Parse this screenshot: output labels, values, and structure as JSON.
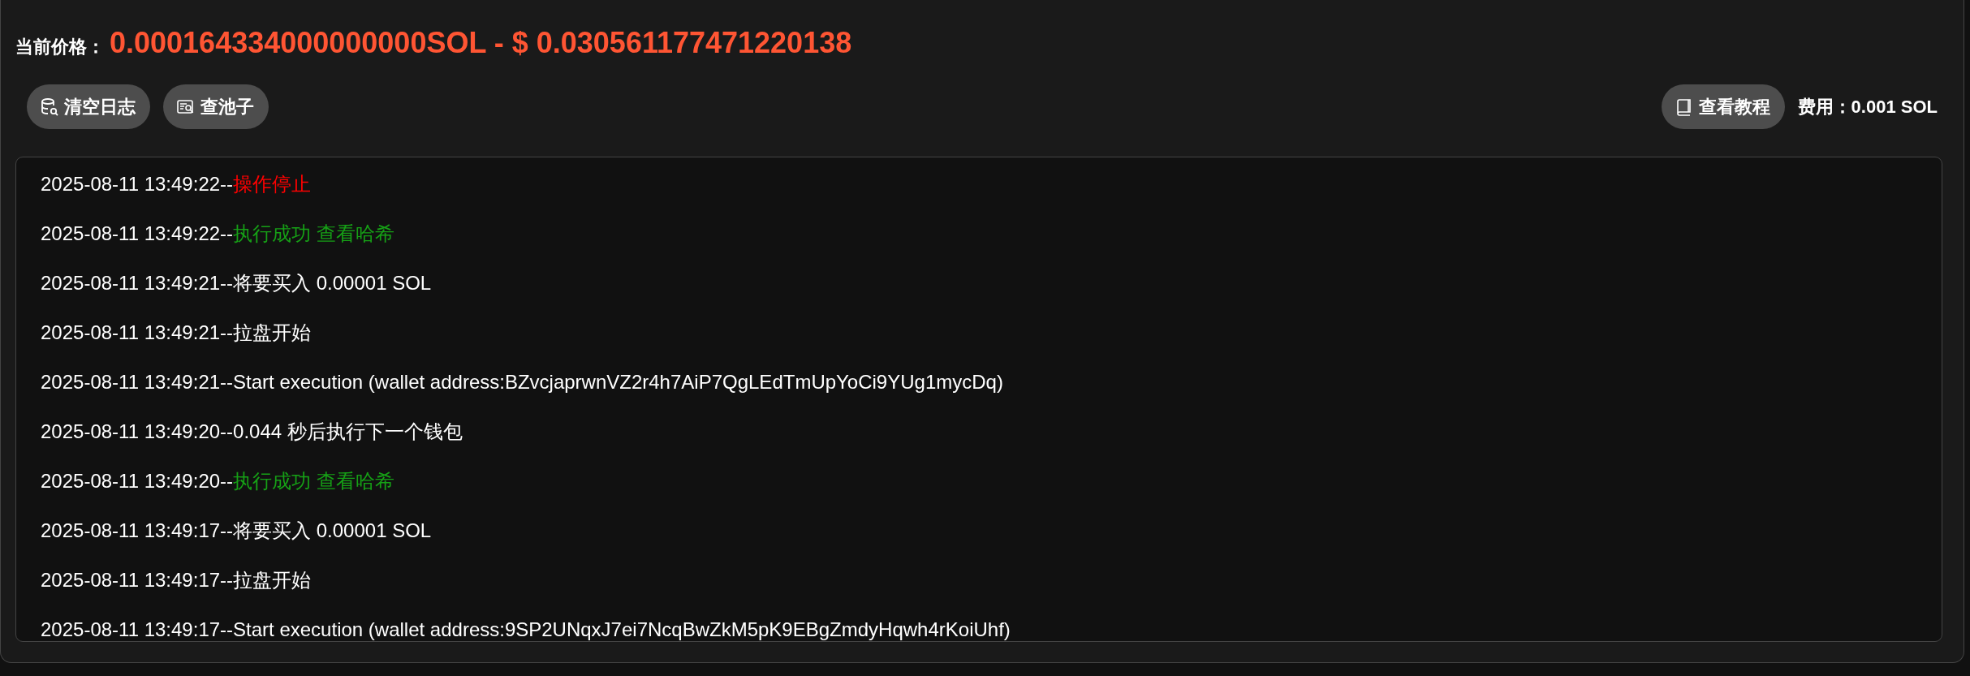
{
  "price": {
    "label": "当前价格：",
    "value": "0.000164334000000000SOL - $ 0.030561177471220138"
  },
  "toolbar": {
    "left_buttons": [
      {
        "label": "清空日志",
        "kind": "clear"
      },
      {
        "label": "查池子",
        "kind": "pool"
      }
    ],
    "right_buttons": [
      {
        "label": "查看教程",
        "kind": "tutorial"
      }
    ],
    "fee": "费用：0.001 SOL"
  },
  "log": [
    {
      "time": "2025-08-11 13:49:22--",
      "kind": "error",
      "text": "操作停止"
    },
    {
      "time": "2025-08-11 13:49:22--",
      "kind": "success",
      "text": "执行成功",
      "link": "查看哈希"
    },
    {
      "time": "2025-08-11 13:49:21--",
      "kind": "info",
      "text": "将要买入 0.00001 SOL"
    },
    {
      "time": "2025-08-11 13:49:21--",
      "kind": "info",
      "text": "拉盘开始"
    },
    {
      "time": "2025-08-11 13:49:21--",
      "kind": "info",
      "text": "Start execution (wallet address:BZvcjaprwnVZ2r4h7AiP7QgLEdTmUpYoCi9YUg1mycDq)"
    },
    {
      "time": "2025-08-11 13:49:20--",
      "kind": "info",
      "text": "0.044 秒后执行下一个钱包"
    },
    {
      "time": "2025-08-11 13:49:20--",
      "kind": "success",
      "text": "执行成功",
      "link": "查看哈希"
    },
    {
      "time": "2025-08-11 13:49:17--",
      "kind": "info",
      "text": "将要买入 0.00001 SOL"
    },
    {
      "time": "2025-08-11 13:49:17--",
      "kind": "info",
      "text": "拉盘开始"
    },
    {
      "time": "2025-08-11 13:49:17--",
      "kind": "info",
      "text": "Start execution (wallet address:9SP2UNqxJ7ei7NcqBwZkM5pK9EBgZmdyHqwh4rKoiUhf)"
    }
  ]
}
